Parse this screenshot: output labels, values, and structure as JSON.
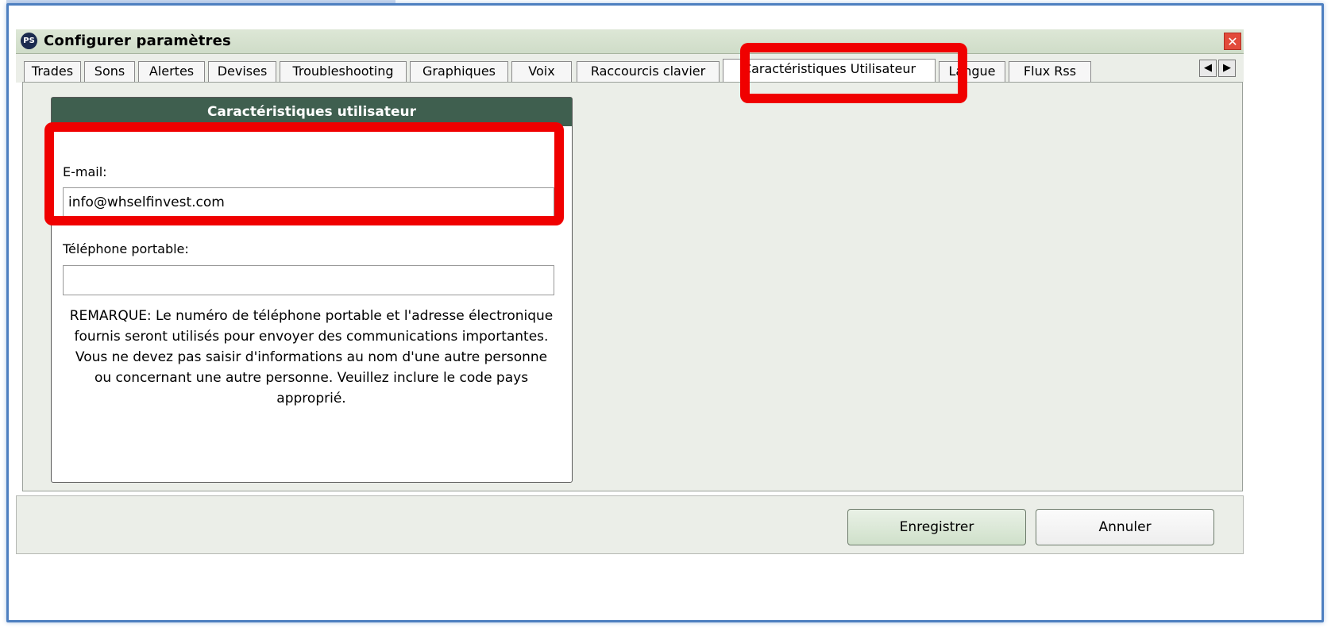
{
  "window": {
    "logo_text": "PS",
    "title": "Configurer paramètres",
    "close_symbol": "✕"
  },
  "tabs": [
    {
      "label": "Trades"
    },
    {
      "label": "Sons"
    },
    {
      "label": "Alertes"
    },
    {
      "label": "Devises"
    },
    {
      "label": "Troubleshooting"
    },
    {
      "label": "Graphiques"
    },
    {
      "label": "Voix"
    },
    {
      "label": "Raccourcis clavier"
    },
    {
      "label": "Caractéristiques Utilisateur",
      "active": true
    },
    {
      "label": "Langue"
    },
    {
      "label": "Flux Rss"
    }
  ],
  "tab_scroll": {
    "left": "◀",
    "right": "▶"
  },
  "panel": {
    "title": "Caractéristiques utilisateur",
    "email_label": "E-mail:",
    "email_value": "info@whselfinvest.com",
    "phone_label": "Téléphone portable:",
    "phone_value": "",
    "remark": "REMARQUE: Le numéro de téléphone portable et l'adresse électronique fournis seront utilisés pour envoyer des communications importantes. Vous ne devez pas saisir d'informations au nom d'une autre personne ou concernant une autre personne. Veuillez inclure le code pays approprié."
  },
  "footer": {
    "save_label": "Enregistrer",
    "cancel_label": "Annuler"
  },
  "colors": {
    "frame": "#4d7fc0",
    "titlebar": "#d8e3d1",
    "panel_header": "#3f5f4f",
    "highlight": "#f00000",
    "close_button": "#e24b3b"
  }
}
